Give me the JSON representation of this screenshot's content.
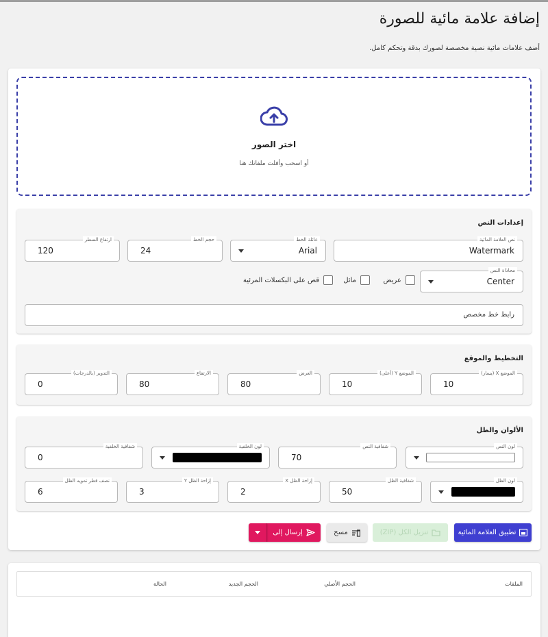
{
  "page": {
    "title": "إضافة علامة مائية للصورة",
    "subtitle": "أضف علامات مائية نصية مخصصة لصورك بدقة وتحكم كامل."
  },
  "dropzone": {
    "title": "اختر الصور",
    "subtitle": "أو اسحب وأفلت ملفاتك هنا"
  },
  "text_settings": {
    "title": "إعدادات النص",
    "watermark_text": {
      "label": "نص العلامة المائية",
      "value": "Watermark"
    },
    "font_family": {
      "label": "عائلة الخط",
      "value": "Arial"
    },
    "font_size": {
      "label": "حجم الخط",
      "value": "24"
    },
    "line_height": {
      "label": "ارتفاع السطر",
      "value": "120"
    },
    "text_align": {
      "label": "محاذاة النص",
      "value": "Center"
    },
    "bold_label": "عريض",
    "italic_label": "مائل",
    "clip_label": "قص على البكسلات المرئية",
    "custom_font_placeholder": "رابط خط مخصص"
  },
  "layout": {
    "title": "التخطيط والموقع",
    "pos_x": {
      "label": "الموضع X (يسار)",
      "value": "10"
    },
    "pos_y": {
      "label": "الموضع Y (أعلى)",
      "value": "10"
    },
    "width": {
      "label": "العرض",
      "value": "80"
    },
    "height": {
      "label": "الارتفاع",
      "value": "80"
    },
    "rotation": {
      "label": "التدوير (بالدرجات)",
      "value": "0"
    }
  },
  "colors": {
    "title": "الألوان والظل",
    "text_color": {
      "label": "لون النص",
      "color": "#ffffff"
    },
    "text_opacity": {
      "label": "شفافية النص",
      "value": "70"
    },
    "bg_color": {
      "label": "لون الخلفية",
      "color": "#000000"
    },
    "bg_opacity": {
      "label": "شفافية الخلفية",
      "value": "0"
    },
    "shadow_color": {
      "label": "لون الظل",
      "color": "#000000"
    },
    "shadow_opacity": {
      "label": "شفافية الظل",
      "value": "50"
    },
    "shadow_x": {
      "label": "إزاحة الظل X",
      "value": "2"
    },
    "shadow_y": {
      "label": "إزاحة الظل Y",
      "value": "3"
    },
    "shadow_blur": {
      "label": "نصف قطر تمويه الظل",
      "value": "6"
    }
  },
  "actions": {
    "apply": "تطبيق العلامة المائية",
    "download_zip": "تنزيل الكل (ZIP)",
    "clear": "مسح",
    "send_to": "إرسال إلى"
  },
  "table": {
    "headers": [
      "الملفات",
      "الحجم الأصلي",
      "الحجم الجديد",
      "الحالة"
    ]
  },
  "theme": {
    "primary": "#3f3fd1",
    "accent": "#e0185f",
    "success_light": "#d9efd9"
  }
}
